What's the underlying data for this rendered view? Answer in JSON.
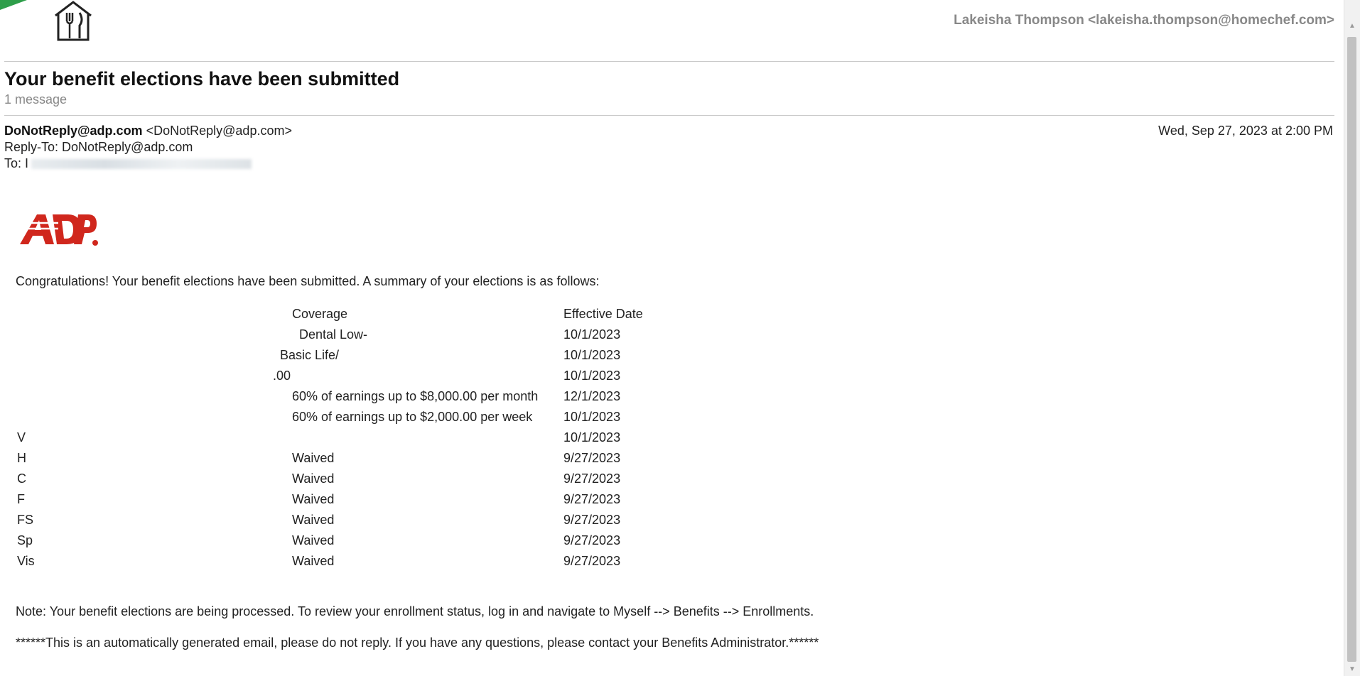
{
  "account": {
    "label": "Lakeisha Thompson <lakeisha.thompson@homechef.com>"
  },
  "email": {
    "subject": "Your benefit elections have been submitted",
    "message_count": "1 message",
    "from_name": "DoNotReply@adp.com",
    "from_address": "<DoNotReply@adp.com>",
    "reply_to": "Reply-To: DoNotReply@adp.com",
    "to_label": "To: I",
    "date": "Wed, Sep 27, 2023 at 2:00 PM"
  },
  "body": {
    "intro": "Congratulations! Your benefit elections have been submitted. A summary of your elections is as follows:",
    "table": {
      "headers": {
        "plan": "",
        "coverage": "Coverage",
        "effective_date": "Effective Date"
      },
      "rows": [
        {
          "plan": "",
          "coverage": "Dental Low-",
          "date": "10/1/2023"
        },
        {
          "plan": "",
          "coverage": "Basic Life/",
          "date": "10/1/2023"
        },
        {
          "plan": "",
          "coverage": ".00",
          "date": "10/1/2023"
        },
        {
          "plan": "",
          "coverage": "60% of earnings up to $8,000.00 per month",
          "date": "12/1/2023"
        },
        {
          "plan": "",
          "coverage": "60% of earnings up to $2,000.00 per week",
          "date": "10/1/2023"
        },
        {
          "plan": "V",
          "coverage": "",
          "date": "10/1/2023"
        },
        {
          "plan": "H",
          "coverage": "Waived",
          "date": "9/27/2023"
        },
        {
          "plan": "C",
          "coverage": "Waived",
          "date": "9/27/2023"
        },
        {
          "plan": "F",
          "coverage": "Waived",
          "date": "9/27/2023"
        },
        {
          "plan": "FS",
          "coverage": "Waived",
          "date": "9/27/2023"
        },
        {
          "plan": "Sp",
          "coverage": "Waived",
          "date": "9/27/2023"
        },
        {
          "plan": "Vis",
          "coverage": "Waived",
          "date": "9/27/2023"
        }
      ]
    },
    "note": "Note: Your benefit elections are being processed. To review your enrollment status, log in and navigate to Myself --> Benefits --> Enrollments.",
    "auto_notice": "******This is an automatically generated email, please do not reply. If you have any questions, please contact your Benefits Administrator.******"
  },
  "icons": {
    "app_logo": "fork-knife-house-icon",
    "sender_logo": "adp-logo"
  },
  "colors": {
    "adp_red": "#d0271d",
    "accent_green": "#2e9e4a",
    "muted_text": "#888888"
  }
}
